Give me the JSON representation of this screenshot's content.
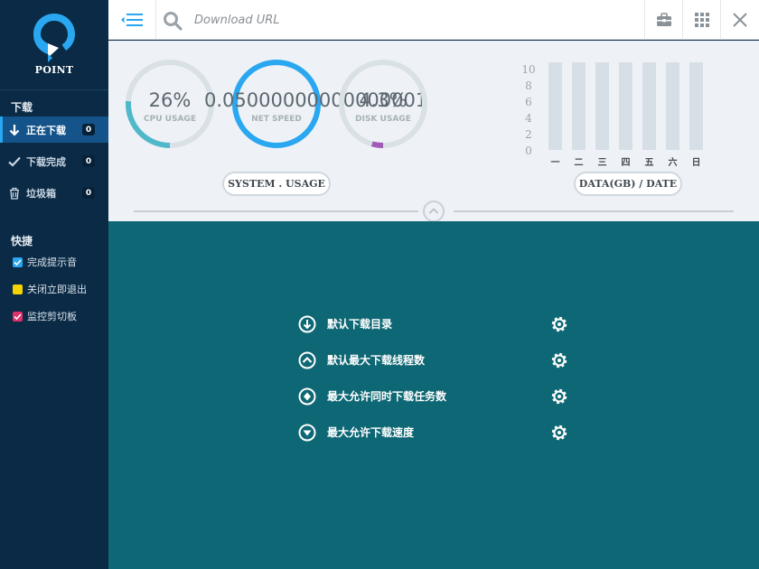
{
  "app": {
    "name": "POINT",
    "accent": "#29a7f0",
    "sidebar_bg": "#0b2a45",
    "settings_bg": "#0e6774"
  },
  "sidebar": {
    "download_section": "下载",
    "nav": [
      {
        "label": "正在下载",
        "count": "0",
        "icon": "arrow-down-icon",
        "active": true
      },
      {
        "label": "下载完成",
        "count": "0",
        "icon": "checkmark-icon",
        "active": false
      },
      {
        "label": "垃圾箱",
        "count": "0",
        "icon": "trash-icon",
        "active": false
      }
    ],
    "shortcut_section": "快捷",
    "options": [
      {
        "label": "完成提示音",
        "checked": true,
        "color": "#29a7f0"
      },
      {
        "label": "关闭立即退出",
        "checked": false,
        "color": "#f5d300"
      },
      {
        "label": "监控剪切板",
        "checked": true,
        "color": "#e0306a"
      }
    ]
  },
  "topbar": {
    "url_placeholder": "Download URL",
    "icons": [
      "menu-collapse-icon",
      "search-icon",
      "toolbox-icon",
      "grid-icon",
      "close-icon"
    ]
  },
  "stats": {
    "gauges": [
      {
        "label": "CPU USAGE",
        "value_text": "26%",
        "fraction": 0.26,
        "color": "#4fb8c9"
      },
      {
        "label": "NET SPEED",
        "value_text": "0.05000000000000001",
        "fraction": 1.0,
        "color": "#29a7f0"
      },
      {
        "label": "DISK USAGE",
        "value_text": "4.3%",
        "fraction": 0.043,
        "color": "#a05bb5"
      }
    ],
    "system_usage_button": "SYSTEM . USAGE",
    "data_date_button": "DATA(GB) / DATE"
  },
  "chart_data": {
    "type": "bar",
    "categories": [
      "一",
      "二",
      "三",
      "四",
      "五",
      "六",
      "日"
    ],
    "values": [
      0,
      0,
      0,
      0,
      0,
      0,
      0
    ],
    "yticks": [
      "10",
      "8",
      "6",
      "4",
      "2",
      "0"
    ],
    "ylim": [
      0,
      10
    ],
    "title": "",
    "xlabel": "",
    "ylabel": ""
  },
  "settings": [
    {
      "label": "默认下载目录",
      "icon": "arrow-down-circle-icon"
    },
    {
      "label": "默认最大下载线程数",
      "icon": "chevron-up-circle-icon"
    },
    {
      "label": "最大允许同时下载任务数",
      "icon": "diamond-circle-icon"
    },
    {
      "label": "最大允许下载速度",
      "icon": "triangle-down-circle-icon"
    }
  ]
}
